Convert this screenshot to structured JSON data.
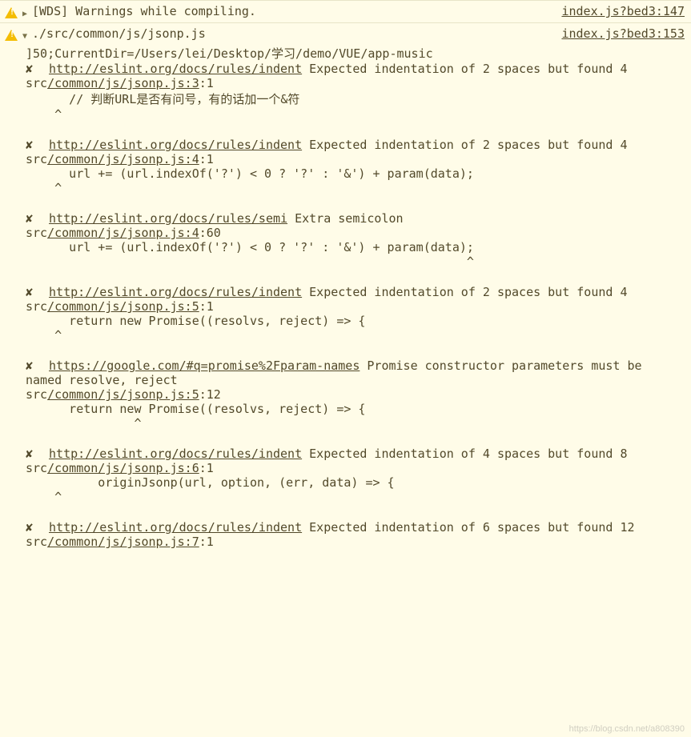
{
  "header": {
    "message": "[WDS] Warnings while compiling.",
    "source": "index.js?bed3:147"
  },
  "main": {
    "message": "./src/common/js/jsonp.js",
    "source": "index.js?bed3:153",
    "preline": "]50;CurrentDir=/Users/lei/Desktop/学习/demo/VUE/app-music"
  },
  "errors": [
    {
      "rule_url": "http://eslint.org/docs/rules/indent",
      "err_text": "Expected indentation of 2 spaces but found 4",
      "src_prefix": "src",
      "src_path": "/common/js/jsonp.js:3",
      "src_suffix": ":1",
      "code": "    // 判断URL是否有问号，有的话加一个&符",
      "caret": "  ^"
    },
    {
      "rule_url": "http://eslint.org/docs/rules/indent",
      "err_text": "Expected indentation of 2 spaces but found 4",
      "src_prefix": "src",
      "src_path": "/common/js/jsonp.js:4",
      "src_suffix": ":1",
      "code": "    url += (url.indexOf('?') < 0 ? '?' : '&') + param(data);",
      "caret": "  ^"
    },
    {
      "rule_url": "http://eslint.org/docs/rules/semi",
      "err_text": "Extra semicolon",
      "src_prefix": "src",
      "src_path": "/common/js/jsonp.js:4",
      "src_suffix": ":60",
      "code": "    url += (url.indexOf('?') < 0 ? '?' : '&') + param(data);",
      "caret": "                                                           ^"
    },
    {
      "rule_url": "http://eslint.org/docs/rules/indent",
      "err_text": "Expected indentation of 2 spaces but found 4",
      "src_prefix": "src",
      "src_path": "/common/js/jsonp.js:5",
      "src_suffix": ":1",
      "code": "    return new Promise((resolvs, reject) => {",
      "caret": "  ^"
    },
    {
      "rule_url": "https://google.com/#q=promise%2Fparam-names",
      "err_text": "Promise constructor parameters must be named resolve, reject",
      "src_prefix": "src",
      "src_path": "/common/js/jsonp.js:5",
      "src_suffix": ":12",
      "code": "    return new Promise((resolvs, reject) => {",
      "caret": "             ^"
    },
    {
      "rule_url": "http://eslint.org/docs/rules/indent",
      "err_text": "Expected indentation of 4 spaces but found 8",
      "src_prefix": "src",
      "src_path": "/common/js/jsonp.js:6",
      "src_suffix": ":1",
      "code": "        originJsonp(url, option, (err, data) => {",
      "caret": "  ^"
    },
    {
      "rule_url": "http://eslint.org/docs/rules/indent",
      "err_text": "Expected indentation of 6 spaces but found 12",
      "src_prefix": "src",
      "src_path": "/common/js/jsonp.js:7",
      "src_suffix": ":1",
      "code": "",
      "caret": ""
    }
  ],
  "watermark": "https://blog.csdn.net/a808390"
}
